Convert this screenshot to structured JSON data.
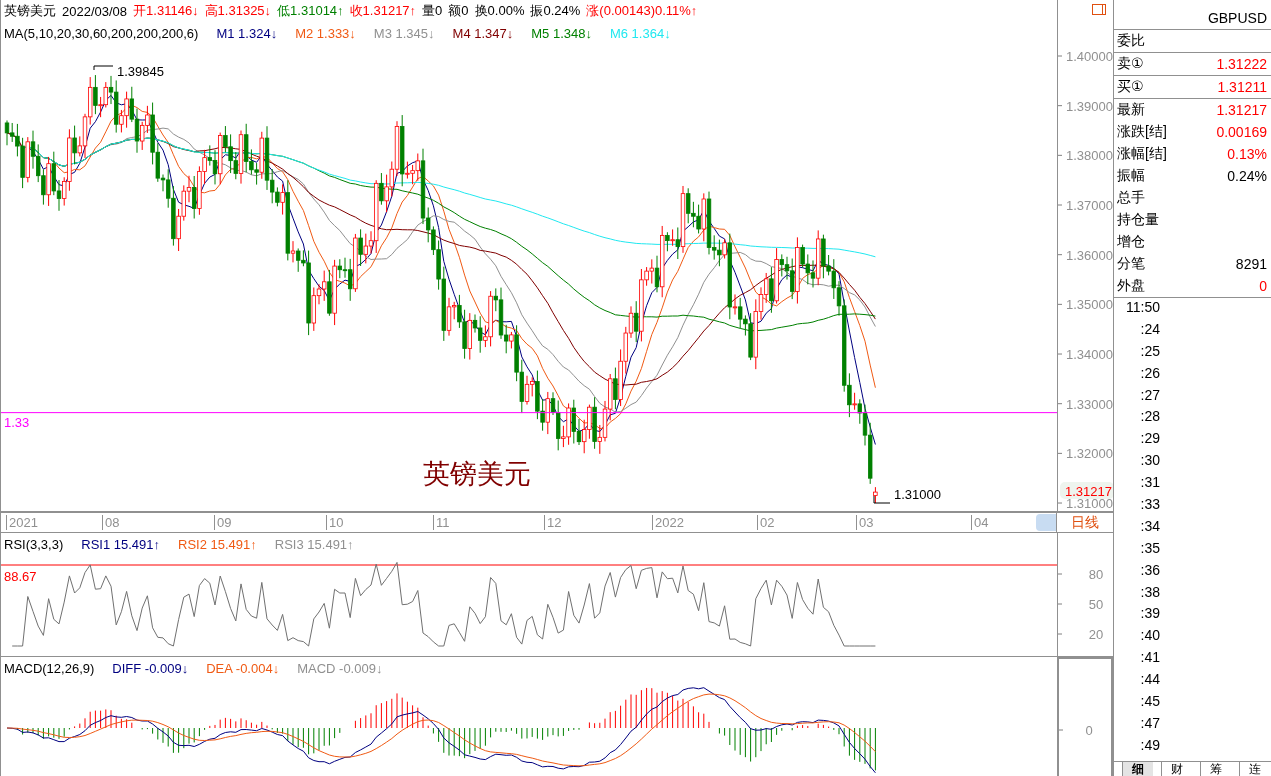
{
  "quote_bar": {
    "name": "英镑美元",
    "date": "2022/03/08",
    "fields": [
      {
        "text": "开1.31146↓",
        "color": "#ff0000"
      },
      {
        "text": "高1.31325↓",
        "color": "#ff0000"
      },
      {
        "text": "低1.31014↑",
        "color": "#008000"
      },
      {
        "text": "收1.31217↑",
        "color": "#ff0000"
      },
      {
        "text": "量0"
      },
      {
        "text": "额0"
      },
      {
        "text": "换0.00%"
      },
      {
        "text": "振0.24%"
      },
      {
        "text": "涨(0.00143)0.11%↑",
        "color": "#ff0000"
      }
    ]
  },
  "ma_legend": {
    "label": "MA(5,10,20,30,60,200,200,200,6)",
    "lines": [
      {
        "text": "M1 1.324↓",
        "color": "#000080"
      },
      {
        "text": "M2 1.333↓",
        "color": "#f05a14"
      },
      {
        "text": "M3 1.345↓",
        "color": "#909090"
      },
      {
        "text": "M4 1.347↓",
        "color": "#800000"
      },
      {
        "text": "M5 1.348↓",
        "color": "#008000"
      },
      {
        "text": "M6 1.364↓",
        "color": "#20e8f0"
      }
    ]
  },
  "price_chart": {
    "title": "英镑美元",
    "high_label": "1.39845",
    "low_label": "1.31000",
    "line_label": "1.33",
    "axis_labels": [
      "1.40000",
      "1.39000",
      "1.38000",
      "1.37000",
      "1.36000",
      "1.35000",
      "1.34000",
      "1.33000",
      "1.32000",
      "1.31000"
    ],
    "last_price": "1.31217"
  },
  "date_axis": {
    "labels": [
      "2021",
      "08",
      "09",
      "10",
      "11",
      "12",
      "2022",
      "02",
      "03",
      "04"
    ],
    "period": "日线"
  },
  "rsi": {
    "label": "RSI(3,3,3)",
    "lines": [
      {
        "text": "RSI1 15.491↑",
        "color": "#000080"
      },
      {
        "text": "RSI2 15.491↑",
        "color": "#f05a14"
      },
      {
        "text": "RSI3 15.491↑",
        "color": "#909090"
      }
    ],
    "level_label": "88.67",
    "axis_labels": [
      "80",
      "50",
      "20"
    ]
  },
  "macd": {
    "label": "MACD(12,26,9)",
    "lines": [
      {
        "text": "DIFF -0.009↓",
        "color": "#000080"
      },
      {
        "text": "DEA -0.004↓",
        "color": "#f05a14"
      },
      {
        "text": "MACD -0.009↓",
        "color": "#909090"
      }
    ],
    "axis_labels": [
      "0"
    ]
  },
  "quote_panel": {
    "symbol": "GBPUSD",
    "groups": [
      [
        {
          "label": "委比"
        }
      ],
      [
        {
          "label": "卖①",
          "value": "1.31222",
          "color": "#ff0000"
        }
      ],
      [
        {
          "label": "买①",
          "value": "1.31211",
          "color": "#ff0000"
        }
      ],
      [
        {
          "label": "最新",
          "value": "1.31217",
          "color": "#ff0000"
        },
        {
          "label": "涨跌[结]",
          "value": "0.00169",
          "color": "#ff0000"
        },
        {
          "label": "涨幅[结]",
          "value": "0.13%",
          "color": "#ff0000"
        },
        {
          "label": "振幅",
          "value": "0.24%",
          "color": "#000000"
        },
        {
          "label": "总手"
        },
        {
          "label": "持仓量"
        },
        {
          "label": "增仓"
        },
        {
          "label": "分笔",
          "value": "8291",
          "color": "#000000"
        },
        {
          "label": "外盘",
          "value": "0",
          "color": "#ff0000"
        }
      ]
    ]
  },
  "ticks": [
    "11:50",
    ":24",
    ":25",
    ":26",
    ":27",
    ":28",
    ":29",
    ":30",
    ":31",
    ":33",
    ":34",
    ":35",
    ":36",
    ":38",
    ":39",
    ":40",
    ":41",
    ":44",
    ":45",
    ":47",
    ":49"
  ],
  "tabs": [
    {
      "label": "细",
      "selected": true
    },
    {
      "label": "财",
      "selected": false
    },
    {
      "label": "筹",
      "selected": false
    },
    {
      "label": "连",
      "selected": false
    }
  ]
}
